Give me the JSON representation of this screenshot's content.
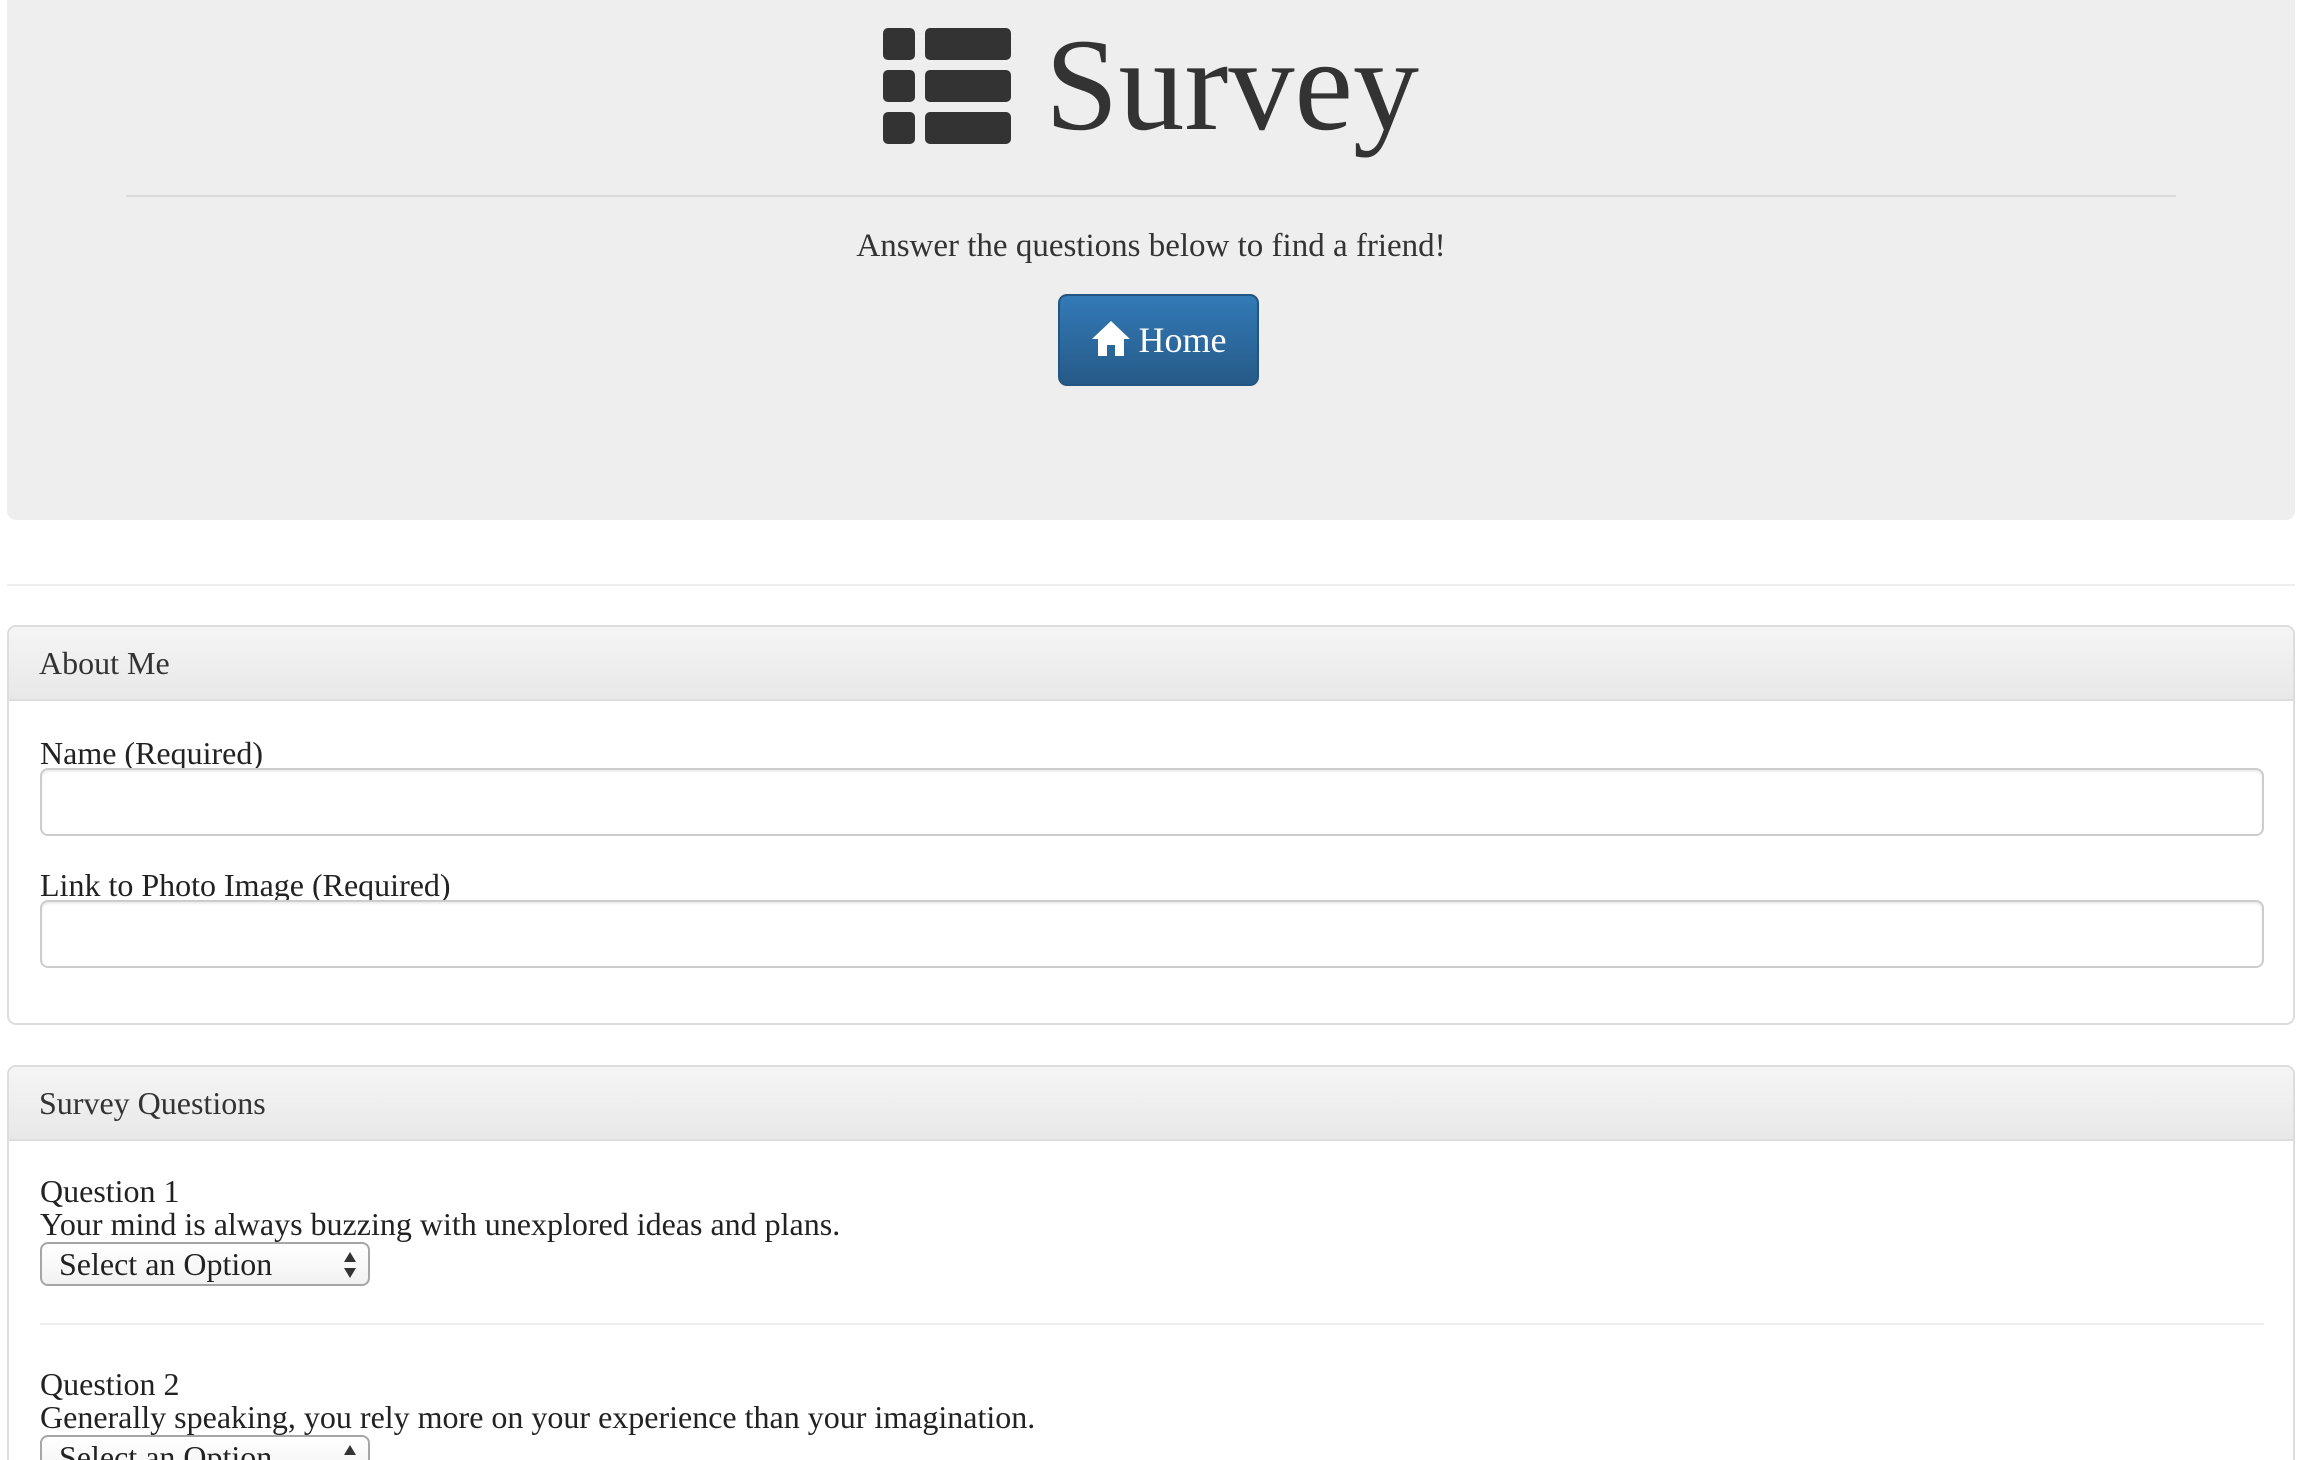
{
  "header": {
    "title": "Survey",
    "title_icon": "list-icon",
    "subtitle": "Answer the questions below to find a friend!",
    "home_button": {
      "label": "Home",
      "icon": "home-icon"
    }
  },
  "about": {
    "heading": "About Me",
    "fields": [
      {
        "label": "Name (Required)",
        "value": "",
        "placeholder": ""
      },
      {
        "label": "Link to Photo Image (Required)",
        "value": "",
        "placeholder": ""
      }
    ]
  },
  "survey": {
    "heading": "Survey Questions",
    "questions": [
      {
        "number": "Question 1",
        "text": "Your mind is always buzzing with unexplored ideas and plans.",
        "selected": "Select an Option"
      },
      {
        "number": "Question 2",
        "text": "Generally speaking, you rely more on your experience than your imagination.",
        "selected": "Select an Option"
      }
    ]
  },
  "colors": {
    "jumbotron_bg": "#eeeeee",
    "button_primary": "#337ab7",
    "text": "#333333"
  }
}
